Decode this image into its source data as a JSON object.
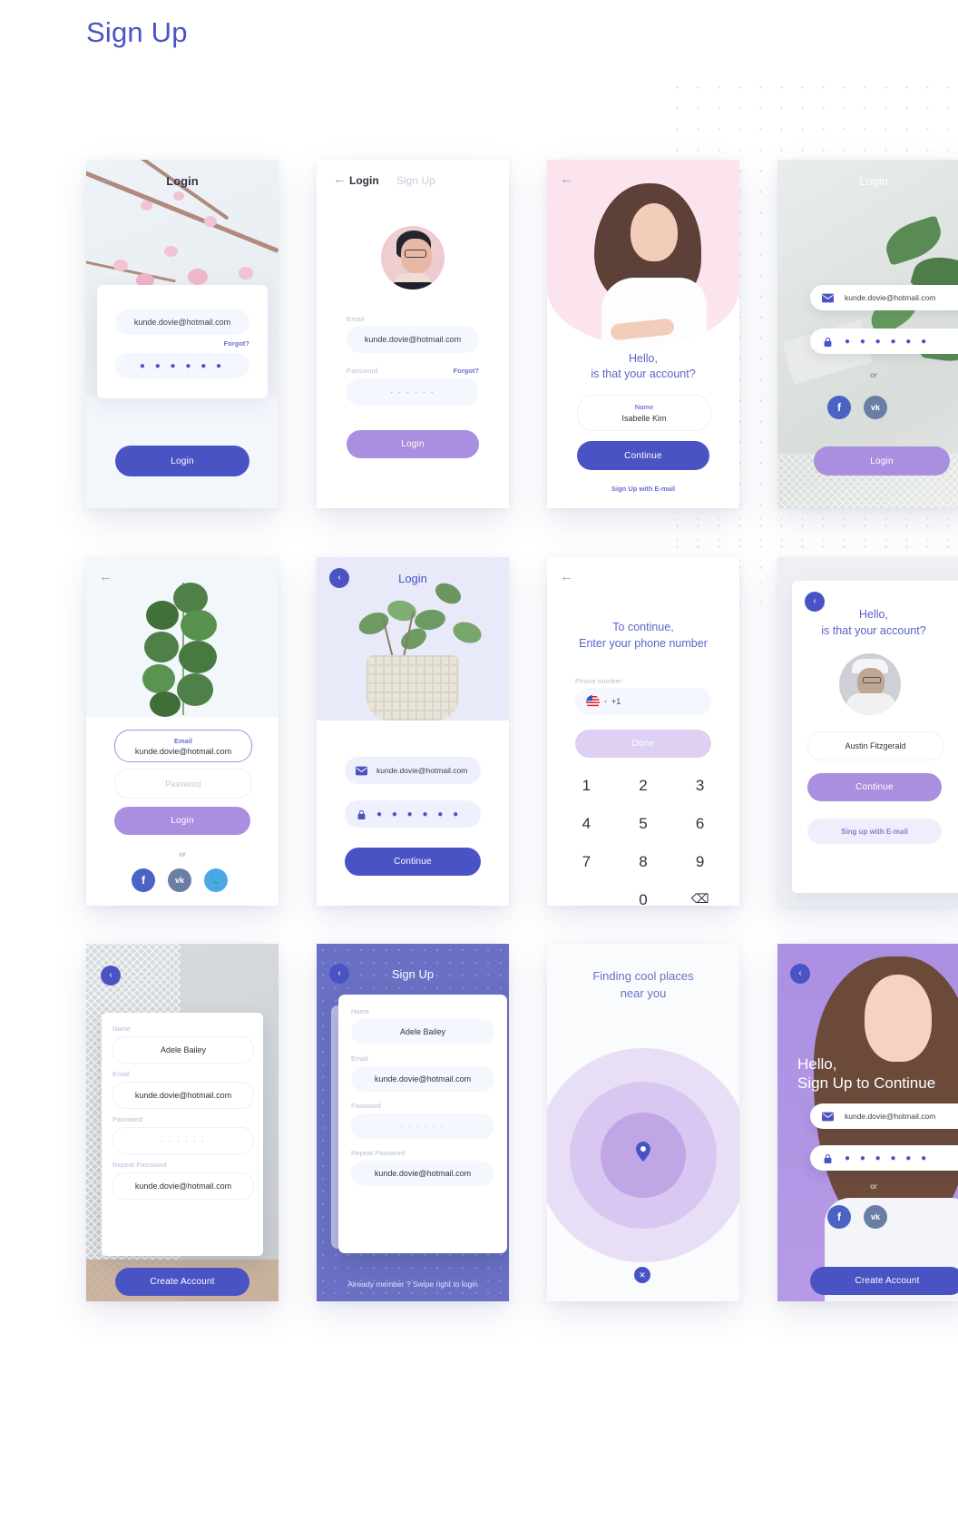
{
  "page": {
    "title": "Sign Up"
  },
  "common": {
    "email_value": "kunde.dovie@hotmail.com",
    "password_dots": "● ● ● ● ● ●",
    "password_dots_small": "·  ·  ·  ·  ·  ·",
    "or_label": "or",
    "back_arrow_icon": "←",
    "back_chevron_icon": "‹"
  },
  "screens": {
    "s1_login_blossom": {
      "nav_title": "Login",
      "email_value": "kunde.dovie@hotmail.com",
      "forgot_label": "Forgot?",
      "password_dots": "● ● ● ● ● ●",
      "login_button": "Login"
    },
    "s2_login_tabs": {
      "tab_login": "Login",
      "tab_signup": "Sign Up",
      "email_label": "Email",
      "email_value": "kunde.dovie@hotmail.com",
      "password_label": "Password",
      "forgot_label": "Forgot?",
      "password_dots": "·  ·  ·  ·  ·  ·",
      "login_button": "Login"
    },
    "s3_account_pink": {
      "headline_line1": "Hello,",
      "headline_line2": "is that your account?",
      "name_label": "Name",
      "name_value": "Isabelle Kim",
      "continue_button": "Continue",
      "signup_link": "Sign Up with E-mail"
    },
    "s4_login_leaf": {
      "nav_title": "Login",
      "email_value": "kunde.dovie@hotmail.com",
      "password_dots": "● ● ● ● ● ●",
      "or_label": "or",
      "social": [
        "facebook",
        "vk"
      ],
      "login_button": "Login"
    },
    "s5_login_plant": {
      "email_label": "Email",
      "email_value": "kunde.dovie@hotmail.com",
      "password_placeholder": "Password",
      "login_button": "Login",
      "or_label": "or",
      "social": [
        "facebook",
        "vk",
        "twitter"
      ]
    },
    "s6_login_pot": {
      "nav_title": "Login",
      "email_value": "kunde.dovie@hotmail.com",
      "password_dots": "● ● ● ● ● ●",
      "continue_button": "Continue"
    },
    "s7_phone": {
      "headline_line1": "To continue,",
      "headline_line2": "Enter your phone number",
      "phone_label": "Phone number",
      "country_flag": "us-flag",
      "country_code": "+1",
      "done_button": "Done",
      "keypad": [
        "1",
        "2",
        "3",
        "4",
        "5",
        "6",
        "7",
        "8",
        "9",
        "",
        "0",
        "⌫"
      ]
    },
    "s8_account_man": {
      "headline_line1": "Hello,",
      "headline_line2": "is that your account?",
      "name_value": "Austin Fitzgerald",
      "continue_button": "Continue",
      "signup_link": "Sing up with E-mail"
    },
    "s9_signup_form": {
      "name_label": "Name",
      "name_value": "Adele Bailey",
      "email_label": "Email",
      "email_value": "kunde.dovie@hotmail.com",
      "password_label": "Password",
      "password_dots": "·  ·  ·  ·  ·  ·",
      "repeat_label": "Repeat Password",
      "repeat_value": "kunde.dovie@hotmail.com",
      "create_button": "Create Account"
    },
    "s10_signup_purple": {
      "nav_title": "Sign Up",
      "name_label": "Name",
      "name_value": "Adele Bailey",
      "email_label": "Email",
      "email_value": "kunde.dovie@hotmail.com",
      "password_label": "Password",
      "password_dots": "·  ·  ·  ·  ·  ·",
      "repeat_label": "Repeat Password",
      "repeat_value": "kunde.dovie@hotmail.com",
      "footer_text": "Already member ? Swipe right to login"
    },
    "s11_finding": {
      "headline_line1": "Finding cool places",
      "headline_line2": "near you",
      "pin_icon": "map-pin",
      "close_icon": "✕"
    },
    "s12_signup_hero": {
      "headline_line1": "Hello,",
      "headline_line2": "Sign Up to Continue",
      "email_value": "kunde.dovie@hotmail.com",
      "password_dots": "● ● ● ● ● ●",
      "or_label": "or",
      "social": [
        "facebook",
        "vk"
      ],
      "create_button": "Create Account"
    }
  },
  "colors": {
    "brand_blue": "#4a53c4",
    "brand_purple": "#aa8ee0",
    "pink_hero": "#fbe4ee",
    "lavender": "#e8eafa",
    "indigo_card": "#6a71c4"
  }
}
